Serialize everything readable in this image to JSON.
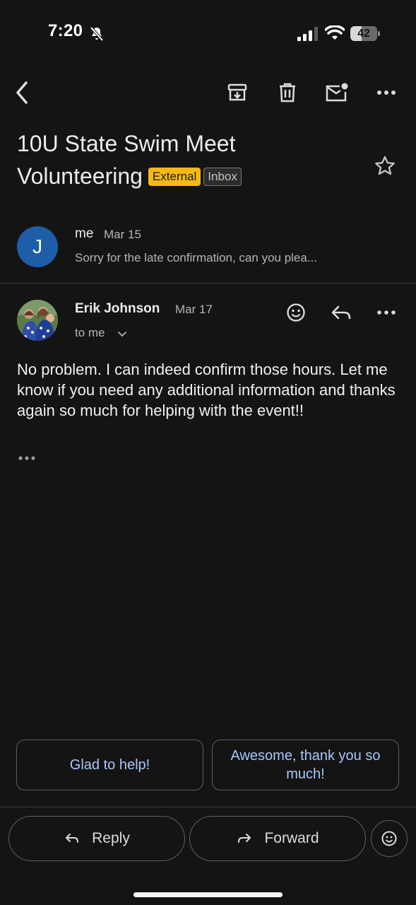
{
  "status_bar": {
    "time": "7:20",
    "battery": "42",
    "battery_level": 0.42
  },
  "toolbar": {
    "back_icon": "chevron-left-icon",
    "archive_icon": "archive-icon",
    "delete_icon": "trash-icon",
    "mark_unread_icon": "mail-unread-icon",
    "more_icon": "more-horizontal-icon"
  },
  "subject": {
    "line1": "10U State Swim Meet",
    "line2": "Volunteering",
    "label_external": "External",
    "label_inbox": "Inbox"
  },
  "thread": {
    "collapsed": {
      "avatar_initial": "J",
      "avatar_color": "#1e5da8",
      "sender": "me",
      "date": "Mar 15",
      "snippet": "Sorry for the late confirmation, can you plea..."
    },
    "expanded": {
      "sender": "Erik Johnson",
      "date": "Mar 17",
      "recipient": "to me",
      "body": "No problem.  I can indeed confirm those hours.  Let me know if you need any additional information and thanks again so much for helping with the event!!"
    }
  },
  "smart_replies": [
    "Glad to help!",
    "Awesome, thank you so much!"
  ],
  "actions": {
    "reply": "Reply",
    "forward": "Forward"
  },
  "colors": {
    "background": "#141414",
    "accent_link": "#a8c7fa",
    "external_badge": "#f6b815"
  }
}
